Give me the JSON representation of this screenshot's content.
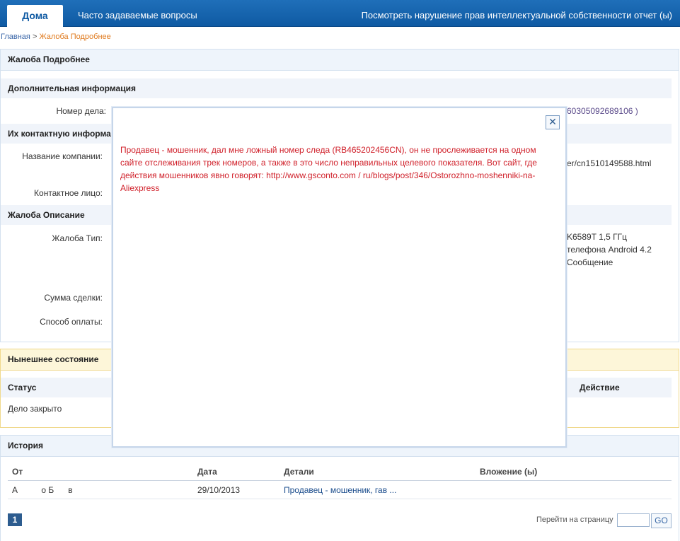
{
  "nav": {
    "home": "Дома",
    "faq": "Часто задаваемые вопросы",
    "report": "Посмотреть нарушение прав интеллектуальной собственности отчет (ы)"
  },
  "breadcrumb": {
    "home": "Главная",
    "separator": ">",
    "current": "Жалоба Подробнее"
  },
  "details": {
    "title": "Жалоба Подробнее",
    "additional_info": "Дополнительная информация",
    "case_number_label": "Номер дела:",
    "case_number_value": "60305092689106 )",
    "contact_info": "Их контактную информац",
    "company_label": "Название компании:",
    "company_value": "er/cn1510149588.html",
    "contact_person_label": "Контактное лицо:",
    "complaint_description": "Жалоба Описание",
    "complaint_type_label": "Жалоба Тип:",
    "complaint_type_lines": [
      "K6589T 1,5 ГГц",
      "телефона Android 4.2",
      "Сообщение"
    ],
    "deal_amount_label": "Сумма сделки:",
    "payment_label": "Способ оплаты:"
  },
  "status": {
    "title": "Нынешнее состояние",
    "status_header": "Статус",
    "action_header": "Действие",
    "status_value": "Дело закрыто"
  },
  "history": {
    "title": "История",
    "columns": {
      "from": "От",
      "date": "Дата",
      "details": "Детали",
      "attachment": "Вложение (ы)"
    },
    "rows": [
      {
        "from": "А          о Б      в",
        "date": "29/10/2013",
        "details": "Продавец - мошенник, гав ..."
      }
    ],
    "page": "1",
    "goto_label": "Перейти на страницу",
    "go_button": "GO"
  },
  "modal": {
    "close": "✕",
    "text": "Продавец - мошенник, дал мне ложный номер следа (RB465202456CN), он не прослеживается на одном сайте отслеживания трек номеров, а также в это число неправильных целевого показателя. Вот сайт, где действия мошенников явно говорят: http://www.gsconto.com / ru/blogs/post/346/Ostorozhno-moshenniki-na-Aliexpress"
  },
  "colors": {
    "nav_blue": "#0f5aa3",
    "modal_text": "#d0202a",
    "breadcrumb_current": "#e07b1f"
  }
}
